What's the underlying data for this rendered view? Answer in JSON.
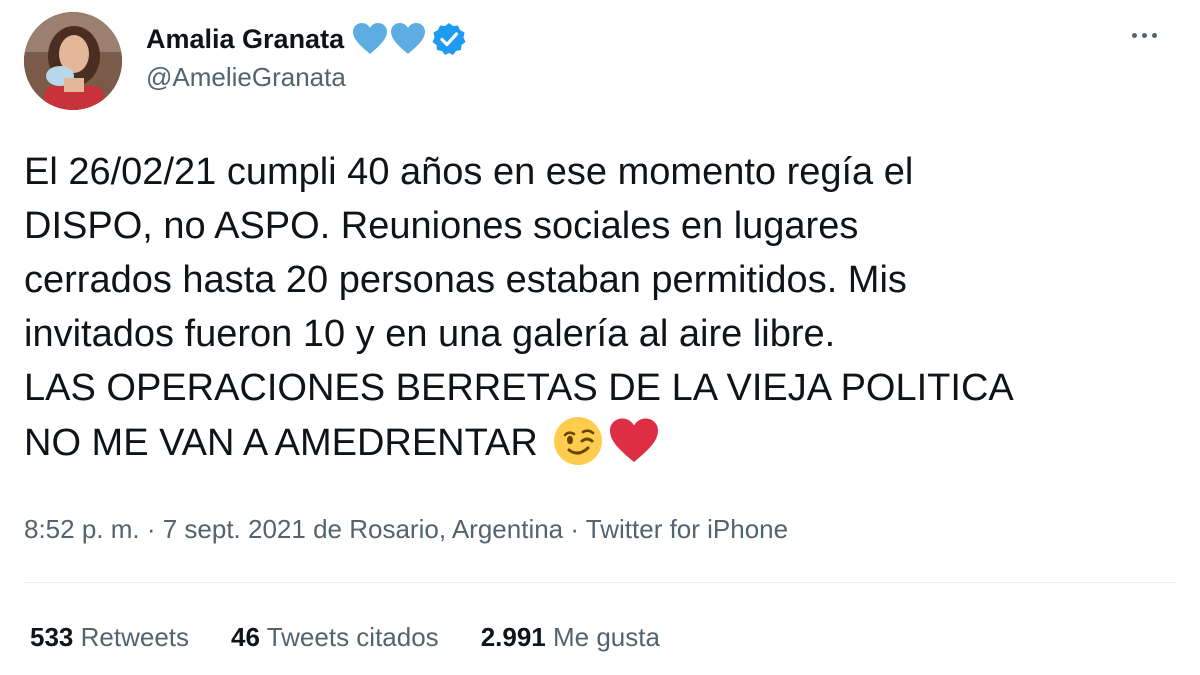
{
  "author": {
    "display_name": "Amalia Granata",
    "handle": "@AmelieGranata",
    "name_emoji": [
      "light-blue-heart-icon",
      "light-blue-heart-icon"
    ],
    "verified": true
  },
  "tweet": {
    "lines": [
      "El 26/02/21 cumpli 40 años en ese momento regía el",
      "DISPO, no ASPO. Reuniones sociales en lugares",
      "cerrados hasta 20 personas estaban permitidos. Mis",
      "invitados fueron 10 y en una galería al aire libre.",
      "LAS OPERACIONES BERRETAS DE LA VIEJA POLITICA",
      "NO ME VAN A AMEDRENTAR"
    ],
    "trailing_emoji": [
      "winking-face-icon",
      "red-heart-icon"
    ]
  },
  "meta": {
    "time": "8:52 p. m.",
    "date": "7 sept. 2021",
    "location": "de Rosario, Argentina",
    "source": "Twitter for iPhone",
    "separator": " · "
  },
  "stats": {
    "retweets": {
      "count": "533",
      "label": "Retweets"
    },
    "quotes": {
      "count": "46",
      "label": "Tweets citados"
    },
    "likes": {
      "count": "2.991",
      "label": "Me gusta"
    }
  },
  "colors": {
    "text_primary": "#0f1419",
    "text_secondary": "#536471",
    "verified_blue": "#1d9bf0",
    "light_blue_heart": "#5dade2",
    "red_heart": "#dd2e44",
    "emoji_yellow": "#ffcc4d",
    "divider": "#e6ecf0"
  }
}
